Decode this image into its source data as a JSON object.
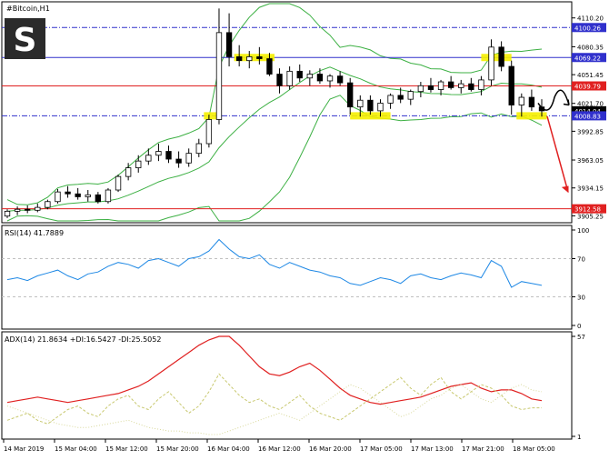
{
  "window": {
    "symbol_label": "#Bitcoin,H1",
    "logo_letter": "S"
  },
  "colors": {
    "candle": "#000000",
    "bollinger": "#3cb043",
    "blue_line": "#3030cc",
    "red_line": "#e02020",
    "highlight": "#f5f000",
    "rsi": "#1e88e5",
    "adx": "#e02020",
    "di_plus": "#c8c86e",
    "di_minus": "#d8d89a",
    "arrow_black": "#000000",
    "arrow_red": "#e02020"
  },
  "chart_data": [
    {
      "type": "candlestick",
      "title": "#Bitcoin,H1",
      "y_ticks": [
        "4110.20",
        "4080.35",
        "4051.45",
        "4021.70",
        "3992.85",
        "3963.05",
        "3934.15",
        "3905.25"
      ],
      "y_tick_values": [
        4110.2,
        4080.35,
        4051.45,
        4021.7,
        3992.85,
        3963.05,
        3934.15,
        3905.25
      ],
      "ylim": [
        3900,
        4125
      ],
      "price_tags": [
        {
          "label": "4100.26",
          "value": 4100.26,
          "style": "blue-dashdot"
        },
        {
          "label": "4069.22",
          "value": 4069.22,
          "style": "blue-solid"
        },
        {
          "label": "4039.79",
          "value": 4039.79,
          "style": "red"
        },
        {
          "label": "4014.04",
          "value": 4014.04,
          "style": "black"
        },
        {
          "label": "4008.83",
          "value": 4008.83,
          "style": "blue-dashdot"
        },
        {
          "label": "3912.58",
          "value": 3912.58,
          "style": "red"
        }
      ],
      "candles": [
        [
          3905,
          3912,
          3903,
          3910
        ],
        [
          3910,
          3915,
          3906,
          3912
        ],
        [
          3912,
          3916,
          3908,
          3911
        ],
        [
          3911,
          3918,
          3909,
          3914
        ],
        [
          3914,
          3922,
          3912,
          3920
        ],
        [
          3920,
          3933,
          3918,
          3930
        ],
        [
          3930,
          3936,
          3924,
          3928
        ],
        [
          3928,
          3934,
          3922,
          3925
        ],
        [
          3925,
          3932,
          3920,
          3927
        ],
        [
          3927,
          3930,
          3918,
          3920
        ],
        [
          3920,
          3934,
          3918,
          3932
        ],
        [
          3932,
          3948,
          3930,
          3946
        ],
        [
          3946,
          3960,
          3942,
          3955
        ],
        [
          3955,
          3968,
          3950,
          3962
        ],
        [
          3962,
          3975,
          3958,
          3968
        ],
        [
          3968,
          3980,
          3962,
          3972
        ],
        [
          3972,
          3978,
          3960,
          3964
        ],
        [
          3964,
          3972,
          3955,
          3960
        ],
        [
          3960,
          3975,
          3956,
          3970
        ],
        [
          3970,
          3985,
          3966,
          3980
        ],
        [
          3980,
          4010,
          3976,
          4005
        ],
        [
          4005,
          4120,
          4000,
          4095
        ],
        [
          4095,
          4115,
          4060,
          4070
        ],
        [
          4070,
          4082,
          4060,
          4066
        ],
        [
          4066,
          4076,
          4058,
          4070
        ],
        [
          4070,
          4080,
          4062,
          4068
        ],
        [
          4068,
          4074,
          4050,
          4052
        ],
        [
          4052,
          4058,
          4032,
          4040
        ],
        [
          4040,
          4060,
          4036,
          4055
        ],
        [
          4055,
          4062,
          4044,
          4048
        ],
        [
          4048,
          4056,
          4040,
          4052
        ],
        [
          4052,
          4058,
          4042,
          4045
        ],
        [
          4045,
          4052,
          4038,
          4050
        ],
        [
          4050,
          4055,
          4040,
          4043
        ],
        [
          4043,
          4048,
          4010,
          4018
        ],
        [
          4018,
          4030,
          4008,
          4025
        ],
        [
          4025,
          4030,
          4010,
          4014
        ],
        [
          4014,
          4026,
          4008,
          4022
        ],
        [
          4022,
          4032,
          4016,
          4030
        ],
        [
          4030,
          4038,
          4022,
          4026
        ],
        [
          4026,
          4036,
          4020,
          4034
        ],
        [
          4034,
          4044,
          4028,
          4040
        ],
        [
          4040,
          4048,
          4033,
          4036
        ],
        [
          4036,
          4046,
          4030,
          4044
        ],
        [
          4044,
          4050,
          4036,
          4038
        ],
        [
          4038,
          4046,
          4032,
          4042
        ],
        [
          4042,
          4048,
          4034,
          4036
        ],
        [
          4036,
          4050,
          4030,
          4046
        ],
        [
          4046,
          4088,
          4040,
          4080
        ],
        [
          4080,
          4086,
          4055,
          4060
        ],
        [
          4060,
          4066,
          4010,
          4020
        ],
        [
          4020,
          4032,
          4008,
          4028
        ],
        [
          4028,
          4036,
          4014,
          4018
        ],
        [
          4018,
          4026,
          4008,
          4014
        ]
      ],
      "x_tick_labels": [
        "14 Mar 2019",
        "15 Mar 04:00",
        "15 Mar 12:00",
        "15 Mar 20:00",
        "16 Mar 04:00",
        "16 Mar 12:00",
        "16 Mar 20:00",
        "17 Mar 05:00",
        "17 Mar 13:00",
        "17 Mar 21:00",
        "18 Mar 05:00"
      ]
    },
    {
      "type": "line",
      "title": "RSI(14) 41.7889",
      "y_ticks": [
        "100",
        "70",
        "30",
        "0"
      ],
      "ylim": [
        0,
        100
      ],
      "levels": [
        70,
        30
      ],
      "series": [
        {
          "name": "RSI(14)",
          "values": [
            48,
            50,
            47,
            52,
            55,
            58,
            52,
            48,
            54,
            56,
            62,
            66,
            64,
            60,
            68,
            70,
            66,
            62,
            70,
            72,
            78,
            90,
            80,
            72,
            70,
            74,
            64,
            60,
            66,
            62,
            58,
            56,
            52,
            50,
            44,
            42,
            46,
            50,
            48,
            44,
            52,
            54,
            50,
            48,
            52,
            55,
            53,
            50,
            68,
            62,
            40,
            46,
            44,
            42
          ]
        }
      ]
    },
    {
      "type": "line",
      "title": "ADX(14) 21.8634 +DI:16.5427 -DI:25.5052",
      "y_ticks": [
        "57",
        "1"
      ],
      "ylim": [
        1,
        57
      ],
      "series": [
        {
          "name": "ADX(14)",
          "values": [
            20,
            21,
            22,
            23,
            22,
            21,
            20,
            21,
            22,
            23,
            24,
            25,
            27,
            29,
            32,
            36,
            40,
            44,
            48,
            52,
            55,
            57,
            57,
            52,
            46,
            40,
            36,
            35,
            37,
            40,
            42,
            38,
            33,
            28,
            24,
            22,
            20,
            19,
            20,
            21,
            22,
            23,
            25,
            27,
            29,
            30,
            31,
            28,
            26,
            27,
            27,
            25,
            22,
            21
          ]
        },
        {
          "name": "+DI",
          "values": [
            10,
            12,
            14,
            10,
            8,
            12,
            16,
            18,
            14,
            12,
            18,
            22,
            24,
            18,
            16,
            22,
            26,
            20,
            14,
            18,
            26,
            36,
            30,
            24,
            20,
            22,
            18,
            16,
            20,
            24,
            18,
            14,
            12,
            10,
            14,
            18,
            22,
            26,
            30,
            34,
            28,
            24,
            30,
            34,
            26,
            22,
            26,
            30,
            28,
            24,
            18,
            16,
            17,
            17
          ]
        },
        {
          "name": "-DI",
          "values": [
            18,
            16,
            14,
            12,
            10,
            8,
            7,
            6,
            6,
            7,
            8,
            9,
            10,
            8,
            6,
            5,
            4,
            4,
            3,
            3,
            2,
            2,
            4,
            6,
            8,
            10,
            12,
            14,
            12,
            10,
            14,
            18,
            22,
            26,
            30,
            28,
            24,
            20,
            16,
            12,
            14,
            18,
            22,
            24,
            28,
            30,
            26,
            22,
            20,
            24,
            28,
            30,
            27,
            26
          ]
        }
      ]
    }
  ]
}
